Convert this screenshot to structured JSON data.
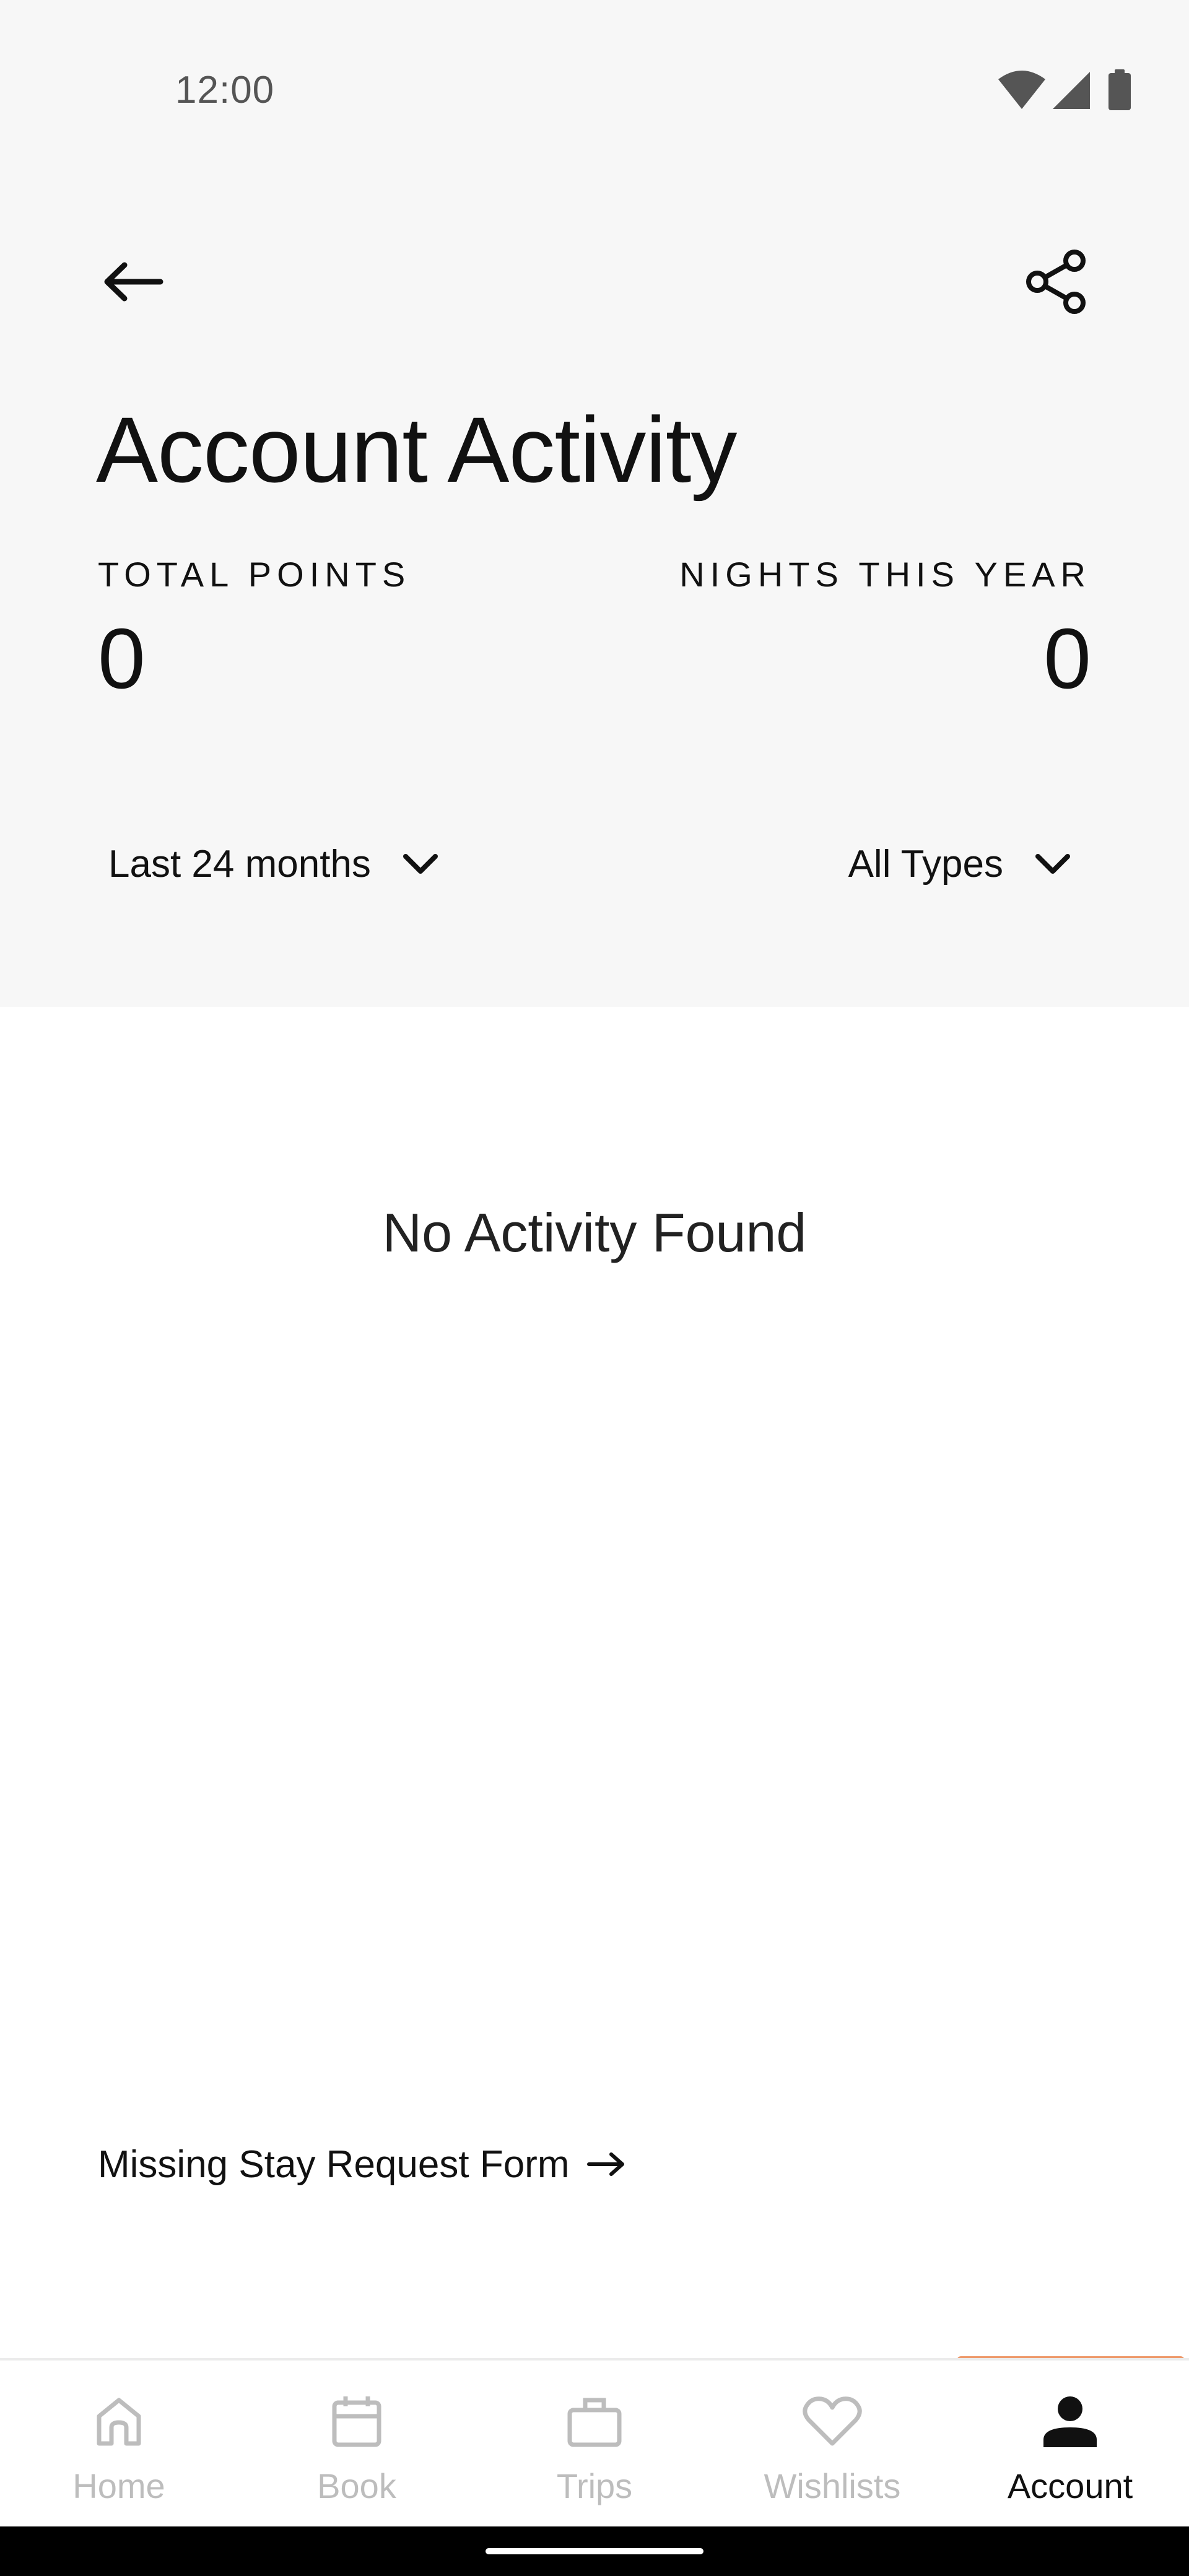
{
  "status_bar": {
    "time": "12:00",
    "icons": [
      "wifi-icon",
      "cellular-signal-icon",
      "battery-icon"
    ]
  },
  "header": {
    "back_icon": "arrow-left-icon",
    "share_icon": "share-icon",
    "title": "Account Activity"
  },
  "stats": {
    "total_points_label": "TOTAL POINTS",
    "total_points_value": "0",
    "nights_label": "NIGHTS THIS YEAR",
    "nights_value": "0"
  },
  "filters": {
    "period": "Last 24 months",
    "type": "All Types"
  },
  "empty_state": {
    "message": "No Activity Found"
  },
  "missing_stay_link": "Missing Stay Request Form",
  "bottom_nav": {
    "items": [
      {
        "label": "Home",
        "icon": "home-icon"
      },
      {
        "label": "Book",
        "icon": "calendar-icon"
      },
      {
        "label": "Trips",
        "icon": "briefcase-icon"
      },
      {
        "label": "Wishlists",
        "icon": "heart-icon"
      },
      {
        "label": "Account",
        "icon": "person-icon"
      }
    ],
    "active": "Account"
  },
  "colors": {
    "header_bg": "#f7f7f7",
    "active_indicator": "#ee9a6c",
    "inactive_nav": "#bdbdbd",
    "text": "#111111"
  }
}
